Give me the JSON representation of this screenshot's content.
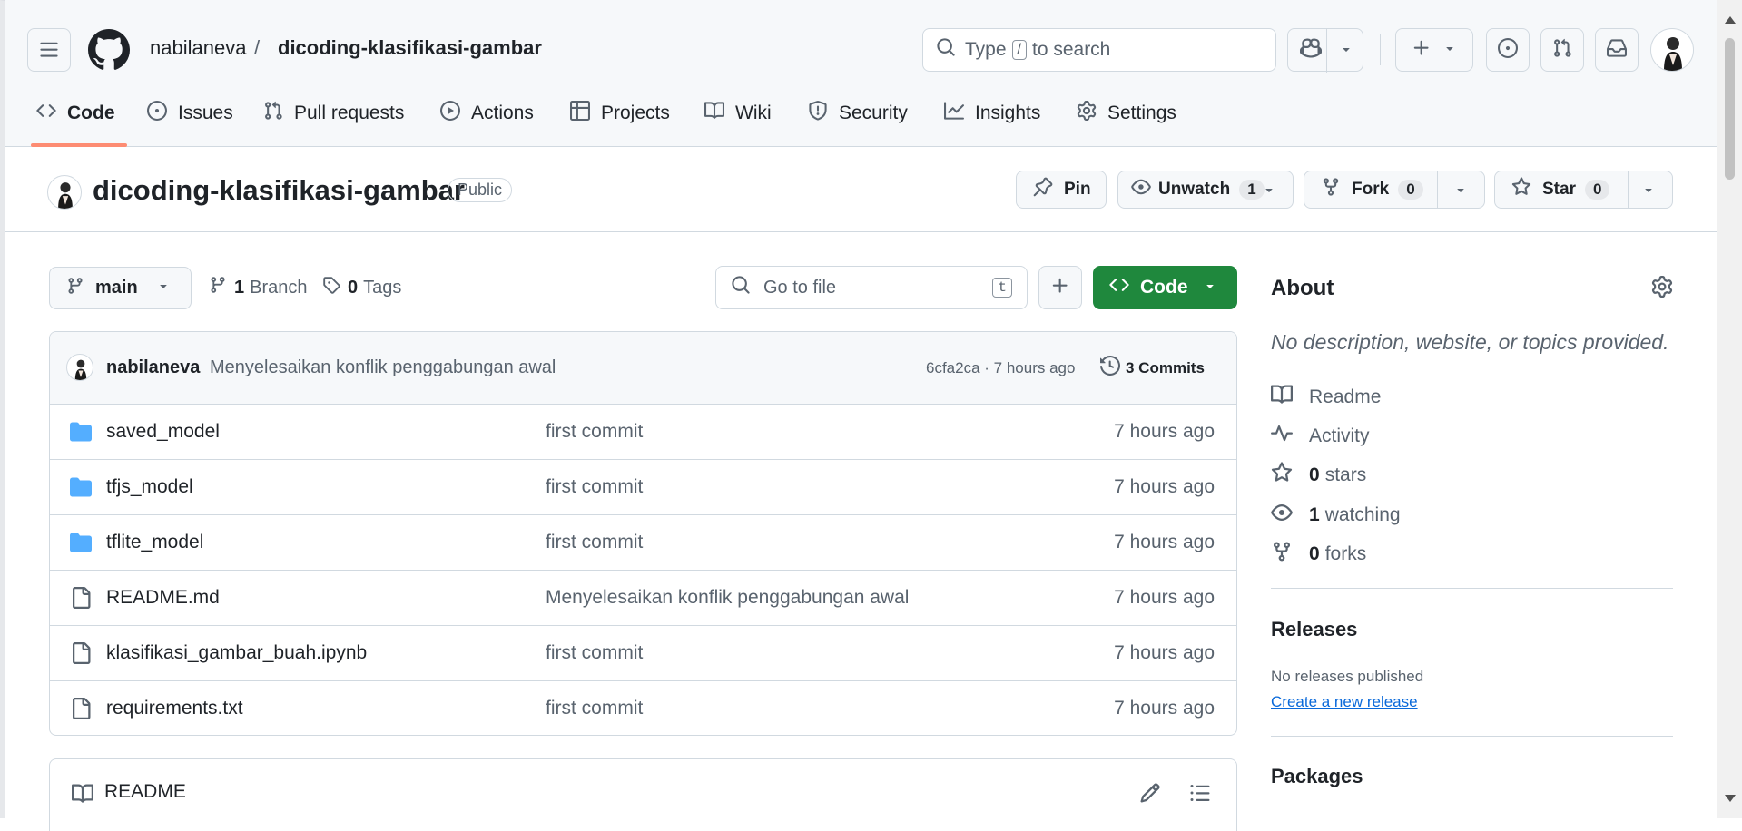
{
  "header": {
    "owner": "nabilaneva",
    "separator": "/",
    "repo": "dicoding-klasifikasi-gambar",
    "search": {
      "prefix": "Type",
      "key": "/",
      "suffix": "to search"
    }
  },
  "tabs": [
    {
      "label": "Code",
      "icon": "code-icon"
    },
    {
      "label": "Issues",
      "icon": "issue-icon"
    },
    {
      "label": "Pull requests",
      "icon": "pull-request-icon"
    },
    {
      "label": "Actions",
      "icon": "play-icon"
    },
    {
      "label": "Projects",
      "icon": "table-icon"
    },
    {
      "label": "Wiki",
      "icon": "book-icon"
    },
    {
      "label": "Security",
      "icon": "shield-icon"
    },
    {
      "label": "Insights",
      "icon": "graph-icon"
    },
    {
      "label": "Settings",
      "icon": "gear-icon"
    }
  ],
  "repo_header": {
    "name": "dicoding-klasifikasi-gambar",
    "visibility": "Public",
    "pin": "Pin",
    "unwatch": "Unwatch",
    "watch_count": "1",
    "fork": "Fork",
    "fork_count": "0",
    "star": "Star",
    "star_count": "0"
  },
  "toolbar": {
    "branch": "main",
    "branch_count": "1",
    "branch_label": "Branch",
    "tag_count": "0",
    "tag_label": "Tags",
    "goto_placeholder": "Go to file",
    "goto_key": "t",
    "code_button": "Code"
  },
  "commit": {
    "author": "nabilaneva",
    "message": "Menyelesaikan konflik penggabungan awal",
    "meta": "6cfa2ca · 7 hours ago",
    "commits": "3 Commits"
  },
  "files": [
    {
      "name": "saved_model",
      "type": "folder",
      "message": "first commit",
      "time": "7 hours ago"
    },
    {
      "name": "tfjs_model",
      "type": "folder",
      "message": "first commit",
      "time": "7 hours ago"
    },
    {
      "name": "tflite_model",
      "type": "folder",
      "message": "first commit",
      "time": "7 hours ago"
    },
    {
      "name": "README.md",
      "type": "file",
      "message": "Menyelesaikan konflik penggabungan awal",
      "time": "7 hours ago"
    },
    {
      "name": "klasifikasi_gambar_buah.ipynb",
      "type": "file",
      "message": "first commit",
      "time": "7 hours ago"
    },
    {
      "name": "requirements.txt",
      "type": "file",
      "message": "first commit",
      "time": "7 hours ago"
    }
  ],
  "readme": {
    "title": "README"
  },
  "about": {
    "title": "About",
    "description": "No description, website, or topics provided.",
    "readme": "Readme",
    "activity": "Activity",
    "stars_count": "0",
    "stars_label": "stars",
    "watching_count": "1",
    "watching_label": "watching",
    "forks_count": "0",
    "forks_label": "forks"
  },
  "releases": {
    "title": "Releases",
    "none": "No releases published",
    "create_link": "Create a new release"
  },
  "packages": {
    "title": "Packages"
  },
  "colors": {
    "green": "#1f883d",
    "link": "#0969da",
    "folder": "#54aeff",
    "tab_underline": "#fd8c73"
  }
}
